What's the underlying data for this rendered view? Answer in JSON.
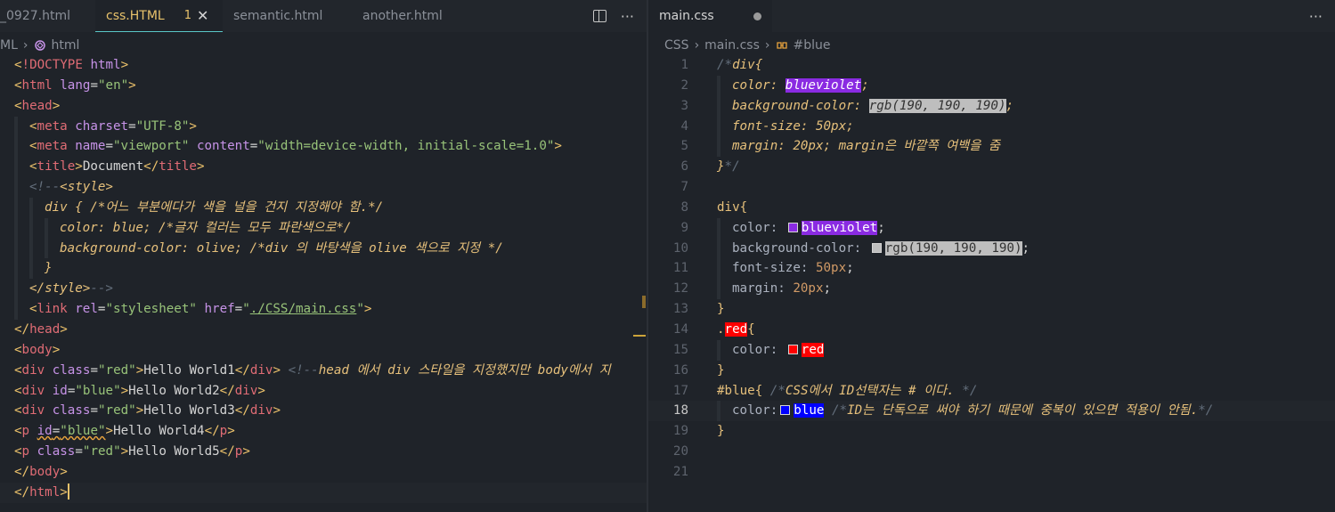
{
  "left_tabs": [
    {
      "label": "_0927.html",
      "active": false
    },
    {
      "label": "css.HTML",
      "active": true,
      "badge": "1",
      "close": "✕"
    },
    {
      "label": "semantic.html",
      "active": false
    },
    {
      "label": "another.html",
      "active": false
    }
  ],
  "left_actions": {
    "more": "···"
  },
  "right_tabs": [
    {
      "label": "main.css",
      "active": true
    }
  ],
  "right_actions": {
    "more": "···"
  },
  "left_breadcrumb": [
    "ML",
    "html"
  ],
  "right_breadcrumb": [
    "CSS",
    "main.css",
    "#blue"
  ],
  "left_code": [
    "<!DOCTYPE html>",
    "<html lang=\"en\">",
    "<head>",
    "<meta charset=\"UTF-8\">",
    "<meta name=\"viewport\" content=\"width=device-width, initial-scale=1.0\">",
    "<title>Document</title>",
    "<!--<style>",
    "div { /*어느 부분에다가 색을 널을 건지 지정해야 함.*/",
    "color: blue; /*글자 컬러는 모두 파란색으로*/",
    "background-color: olive; /*div 의 바탕색을 olive 색으로 지정 */",
    "}",
    "</style>-->",
    "<link rel=\"stylesheet\" href=\"./CSS/main.css\">",
    "</head>",
    "<body>",
    "<div class=\"red\">Hello World1</div> <!--head 에서 div 스타일을 지정했지만 body에서 지",
    "<div id=\"blue\">Hello World2</div>",
    "<div class=\"red\">Hello World3</div>",
    "<p id=\"blue\">Hello World4</p>",
    "<p class=\"red\">Hello World5</p>",
    "</body>",
    "</html>"
  ],
  "right_code": [
    "/*div{",
    "color: blueviolet;",
    "background-color: rgb(190, 190, 190);",
    "font-size: 50px;",
    "margin: 20px; margin은 바깥쪽 여백을 줌",
    "}*/",
    "",
    "div{",
    "color: blueviolet;",
    "background-color: rgb(190, 190, 190);",
    "font-size: 50px;",
    "margin: 20px;",
    "}",
    ".red{",
    "color: red",
    "}",
    "#blue{ /*CSS에서 ID선택자는 # 이다. */",
    "color: blue /*ID는 단독으로 써야 하기 때문에 중복이 있으면 적용이 안됨.*/",
    "}",
    "",
    ""
  ],
  "right_line_numbers": [
    "1",
    "2",
    "3",
    "4",
    "5",
    "6",
    "7",
    "8",
    "9",
    "10",
    "11",
    "12",
    "13",
    "14",
    "15",
    "16",
    "17",
    "18",
    "19",
    "20",
    "21"
  ],
  "current_line": "18",
  "colors": {
    "blueviolet": "#8a2be2",
    "grey": "#bebebe",
    "red": "#ff0000",
    "blue": "#0000ff",
    "accent": "#e8c26b"
  }
}
